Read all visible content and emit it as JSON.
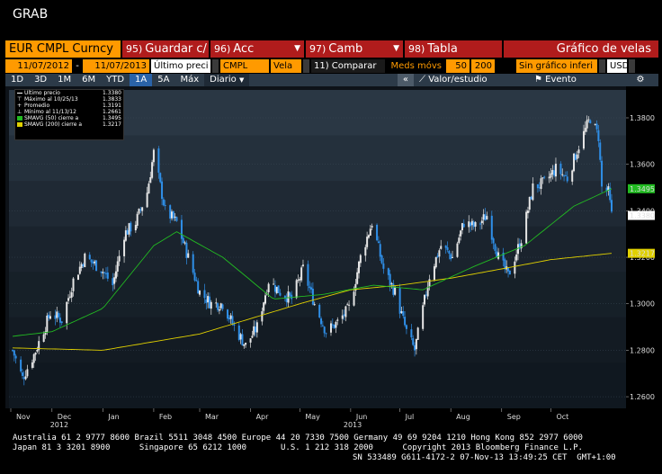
{
  "window": {
    "title": "GRAB"
  },
  "toolbar": {
    "security": "EUR CMPL Curncy",
    "save": {
      "num": "95)",
      "label": "Guardar c/"
    },
    "actions": {
      "num": "96)",
      "label": "Acc"
    },
    "change": {
      "num": "97)",
      "label": "Camb"
    },
    "table": {
      "num": "98)",
      "label": "Tabla"
    },
    "chart_type": "Gráfico de velas"
  },
  "params": {
    "start_date": "11/07/2012",
    "dash": "-",
    "end_date": "11/07/2013",
    "price_field": "Último preci",
    "source": "CMPL",
    "candle": "Vela",
    "compare": "11) Comparar",
    "moving_avgs_label": "Meds móvs",
    "ma_short": "50",
    "ma_long": "200",
    "chart_style": "Sin gráfico inferi",
    "currency": "USD"
  },
  "range_bar": {
    "periods": [
      "1D",
      "3D",
      "1M",
      "6M",
      "YTD",
      "1A",
      "5A",
      "Máx"
    ],
    "active": "1A",
    "frequency": "Diario",
    "collapse": "«",
    "value_study": "Valor/estudio",
    "event": "Evento",
    "settings_icon": "gear-icon"
  },
  "legend": {
    "items": [
      {
        "label": "Último precio",
        "value": "1.3380",
        "icon": "line-white-icon"
      },
      {
        "label": "Máximo al 10/25/13",
        "value": "1.3833",
        "icon": "high-marker-icon"
      },
      {
        "label": "Promedio",
        "value": "1.3191",
        "icon": "average-marker-icon"
      },
      {
        "label": "Mínimo al 11/13/12",
        "value": "1.2661",
        "icon": "low-marker-icon"
      },
      {
        "label": "SMAVG (50) cierre a",
        "value": "1.3495",
        "icon": "green-square-icon"
      },
      {
        "label": "SMAVG (200) cierre a",
        "value": "1.3217",
        "icon": "yellow-square-icon"
      }
    ]
  },
  "colors": {
    "up_candle": "#e6e6e6",
    "down_candle": "#2f8fe8",
    "sma50": "#22bb22",
    "sma200": "#e0d000",
    "last_price_tag": "#ffffff",
    "accent_red": "#b01c1c",
    "accent_orange": "#ff9a00"
  },
  "chart_data": {
    "type": "candlestick",
    "x_labels": [
      "Nov",
      "Dec",
      "Jan",
      "Feb",
      "Mar",
      "Apr",
      "May",
      "Jun",
      "Jul",
      "Aug",
      "Sep",
      "Oct"
    ],
    "year_labels": [
      "2012",
      "2013"
    ],
    "y_ticks": [
      "1.3800",
      "1.3600",
      "1.3400",
      "1.3200",
      "1.3000",
      "1.2800",
      "1.2600"
    ],
    "ylim": [
      1.255,
      1.392
    ],
    "close_anchors": [
      [
        "2012-11-07",
        1.28
      ],
      [
        "2012-11-13",
        1.268
      ],
      [
        "2012-11-20",
        1.278
      ],
      [
        "2012-11-30",
        1.296
      ],
      [
        "2012-12-07",
        1.293
      ],
      [
        "2012-12-14",
        1.31
      ],
      [
        "2012-12-21",
        1.32
      ],
      [
        "2012-12-31",
        1.315
      ],
      [
        "2013-01-07",
        1.308
      ],
      [
        "2013-01-14",
        1.33
      ],
      [
        "2013-01-21",
        1.335
      ],
      [
        "2013-01-28",
        1.348
      ],
      [
        "2013-02-01",
        1.365
      ],
      [
        "2013-02-08",
        1.34
      ],
      [
        "2013-02-15",
        1.335
      ],
      [
        "2013-02-22",
        1.32
      ],
      [
        "2013-03-01",
        1.305
      ],
      [
        "2013-03-08",
        1.3
      ],
      [
        "2013-03-15",
        1.3
      ],
      [
        "2013-03-22",
        1.29
      ],
      [
        "2013-03-29",
        1.282
      ],
      [
        "2013-04-05",
        1.29
      ],
      [
        "2013-04-12",
        1.31
      ],
      [
        "2013-04-19",
        1.305
      ],
      [
        "2013-04-26",
        1.302
      ],
      [
        "2013-05-03",
        1.315
      ],
      [
        "2013-05-10",
        1.3
      ],
      [
        "2013-05-17",
        1.288
      ],
      [
        "2013-05-24",
        1.292
      ],
      [
        "2013-05-31",
        1.298
      ],
      [
        "2013-06-07",
        1.32
      ],
      [
        "2013-06-14",
        1.335
      ],
      [
        "2013-06-21",
        1.315
      ],
      [
        "2013-06-28",
        1.305
      ],
      [
        "2013-07-05",
        1.288
      ],
      [
        "2013-07-10",
        1.28
      ],
      [
        "2013-07-19",
        1.312
      ],
      [
        "2013-07-26",
        1.325
      ],
      [
        "2013-08-02",
        1.32
      ],
      [
        "2013-08-09",
        1.335
      ],
      [
        "2013-08-16",
        1.333
      ],
      [
        "2013-08-23",
        1.338
      ],
      [
        "2013-08-30",
        1.32
      ],
      [
        "2013-09-05",
        1.312
      ],
      [
        "2013-09-13",
        1.328
      ],
      [
        "2013-09-20",
        1.35
      ],
      [
        "2013-09-27",
        1.352
      ],
      [
        "2013-10-04",
        1.358
      ],
      [
        "2013-10-11",
        1.354
      ],
      [
        "2013-10-18",
        1.368
      ],
      [
        "2013-10-25",
        1.38
      ],
      [
        "2013-10-30",
        1.372
      ],
      [
        "2013-11-01",
        1.35
      ],
      [
        "2013-11-05",
        1.348
      ],
      [
        "2013-11-07",
        1.338
      ]
    ],
    "sma50_anchors": [
      [
        "2012-11-07",
        1.286
      ],
      [
        "2012-12-01",
        1.288
      ],
      [
        "2013-01-01",
        1.298
      ],
      [
        "2013-02-01",
        1.325
      ],
      [
        "2013-02-15",
        1.331
      ],
      [
        "2013-03-15",
        1.32
      ],
      [
        "2013-04-15",
        1.302
      ],
      [
        "2013-05-15",
        1.304
      ],
      [
        "2013-06-15",
        1.308
      ],
      [
        "2013-07-15",
        1.306
      ],
      [
        "2013-08-15",
        1.316
      ],
      [
        "2013-09-15",
        1.325
      ],
      [
        "2013-10-15",
        1.342
      ],
      [
        "2013-11-07",
        1.3495
      ]
    ],
    "sma200_anchors": [
      [
        "2012-11-07",
        1.281
      ],
      [
        "2013-01-01",
        1.28
      ],
      [
        "2013-03-01",
        1.287
      ],
      [
        "2013-05-01",
        1.3
      ],
      [
        "2013-06-01",
        1.306
      ],
      [
        "2013-07-01",
        1.308
      ],
      [
        "2013-08-01",
        1.311
      ],
      [
        "2013-09-01",
        1.315
      ],
      [
        "2013-10-01",
        1.319
      ],
      [
        "2013-11-07",
        1.3217
      ]
    ],
    "last_price": 1.338,
    "sma50_last": 1.3495,
    "sma200_last": 1.3217
  },
  "footer": {
    "line1": "Australia 61 2 9777 8600 Brazil 5511 3048 4500 Europe 44 20 7330 7500 Germany 49 69 9204 1210 Hong Kong 852 2977 6000",
    "line2": "Japan 81 3 3201 8900      Singapore 65 6212 1000       U.S. 1 212 318 2000      Copyright 2013 Bloomberg Finance L.P.",
    "line3": "SN 533489 G611-4172-2 07-Nov-13 13:49:25 CET  GMT+1:00"
  }
}
